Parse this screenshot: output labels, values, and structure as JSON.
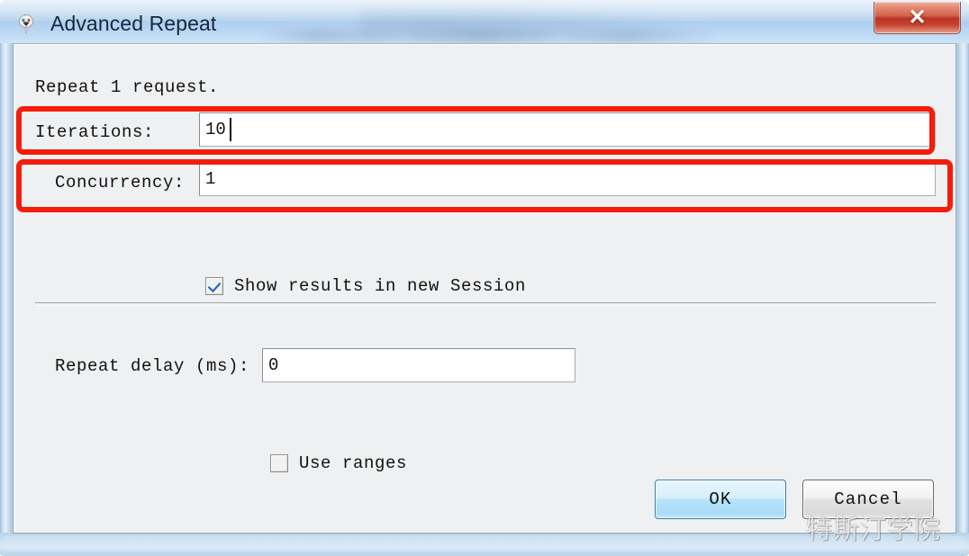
{
  "window": {
    "title": "Advanced Repeat",
    "icon": "fiddler-app-icon",
    "close_label": "✕"
  },
  "dialog": {
    "summary_text": "Repeat 1 request.",
    "fields": [
      {
        "name": "iterations",
        "label": "Iterations:",
        "value": "10",
        "placeholder": ""
      },
      {
        "name": "concurrency",
        "label": "Concurrency:",
        "value": "1",
        "placeholder": ""
      },
      {
        "name": "repeat_delay",
        "label": "Repeat delay (ms):",
        "value": "0",
        "placeholder": ""
      }
    ],
    "checkboxes": [
      {
        "name": "show_results_in_new_session",
        "label": "Show results in new Session",
        "checked": true
      },
      {
        "name": "use_ranges",
        "label": "Use ranges",
        "checked": false
      }
    ],
    "buttons": {
      "ok_label": "OK",
      "cancel_label": "Cancel"
    }
  },
  "annotations": {
    "highlight_color": "#f41d0c",
    "boxes": [
      {
        "target": "iterations-row"
      },
      {
        "target": "concurrency-row"
      }
    ]
  },
  "watermark": {
    "text": "特斯汀学院"
  },
  "colors": {
    "titlebar_top": "#d3e5f6",
    "titlebar_bottom": "#cde3f7",
    "client_bg": "#eff0f1",
    "close_button": "#b93426",
    "ok_button_accent": "#a9dcf8",
    "annotation_red": "#f41d0c"
  }
}
